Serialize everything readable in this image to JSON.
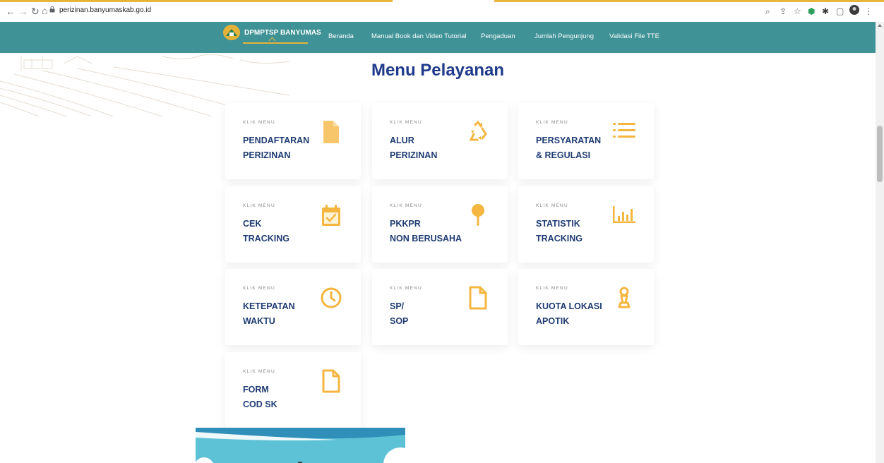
{
  "browser": {
    "url": "perizinan.banyumaskab.go.id",
    "back_icon": "back-arrow-icon",
    "forward_icon": "forward-arrow-icon",
    "reload_icon": "reload-icon",
    "home_icon": "home-icon"
  },
  "header": {
    "logo_text": "DPMPTSP BANYUMAS",
    "nav": [
      "Beranda",
      "Manual Book dan Video Tutorial",
      "Pengaduan",
      "Jumlah Pengunjung",
      "Validasi File TTE"
    ]
  },
  "main": {
    "title": "Menu Pelayanan",
    "cards": [
      {
        "kicker": "KLIK MENU",
        "line1": "PENDAFTARAN",
        "line2": "PERIZINAN",
        "icon": "file-icon"
      },
      {
        "kicker": "KLIK MENU",
        "line1": "ALUR",
        "line2": "PERIZINAN",
        "icon": "recycle-icon"
      },
      {
        "kicker": "KLIK MENU",
        "line1": "PERSYARATAN",
        "line2": "& REGULASI",
        "icon": "list-icon"
      },
      {
        "kicker": "KLIK MENU",
        "line1": "CEK",
        "line2": "TRACKING",
        "icon": "calendar-check-icon"
      },
      {
        "kicker": "KLIK MENU",
        "line1": "PKKPR",
        "line2": "NON BERUSAHA",
        "icon": "pin-icon"
      },
      {
        "kicker": "KLIK MENU",
        "line1": "STATISTIK",
        "line2": "TRACKING",
        "icon": "bar-chart-icon"
      },
      {
        "kicker": "KLIK MENU",
        "line1": "KETEPATAN",
        "line2": "WAKTU",
        "icon": "clock-icon"
      },
      {
        "kicker": "KLIK MENU",
        "line1": "SP/",
        "line2": "SOP",
        "icon": "document-outline-icon"
      },
      {
        "kicker": "KLIK MENU",
        "line1": "KUOTA LOKASI",
        "line2": "APOTIK",
        "icon": "chess-pawn-icon"
      },
      {
        "kicker": "KLIK MENU",
        "line1": "FORM",
        "line2": "COD SK",
        "icon": "document-outline-icon"
      }
    ]
  },
  "colors": {
    "header_bg": "#3f9296",
    "title": "#1f3a8a",
    "card_title": "#1f3b73",
    "icon_accent": "#f4b63f"
  }
}
